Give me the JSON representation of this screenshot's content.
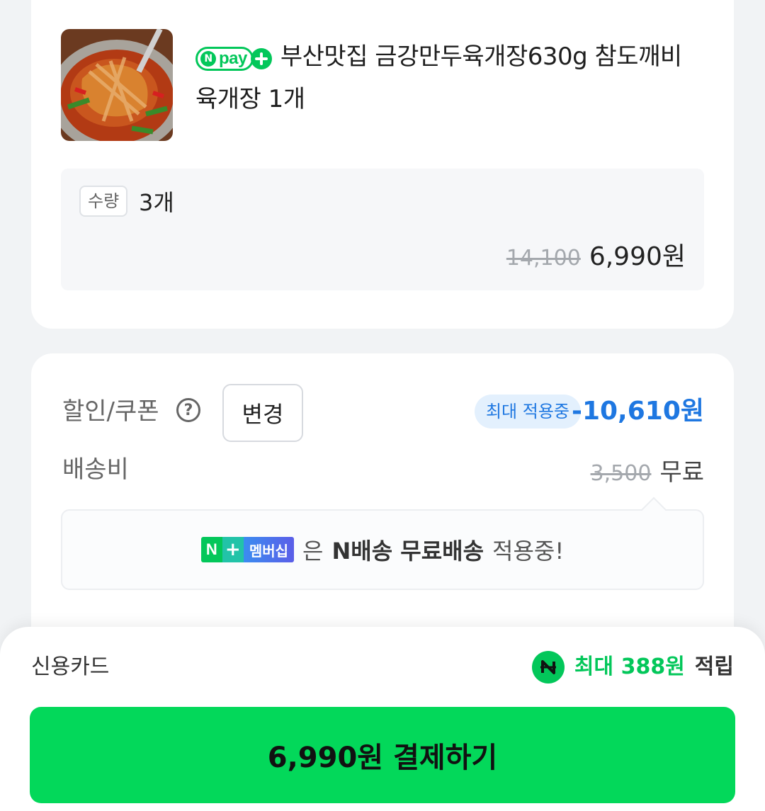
{
  "product": {
    "badge_text": "pay",
    "title": "부산맛집 금강만두육개장630g 참도깨비 육개장 1개",
    "thumbnail_icon": "food-photo",
    "quantity_label": "수량",
    "quantity_value": "3개",
    "original_price": "14,100",
    "price": "6,990원"
  },
  "discount": {
    "label": "할인/쿠폰",
    "help_icon": "question-circle-icon",
    "change_button": "변경",
    "badge": "최대 적용중",
    "amount": "-10,610원"
  },
  "shipping": {
    "label": "배송비",
    "original_fee": "3,500",
    "fee": "무료",
    "membership_badge": {
      "n": "N",
      "plus": "+",
      "text": "멤버십"
    },
    "notice_particle": "은",
    "notice_bold": "N배송 무료배송",
    "notice_tail": "적용중!"
  },
  "payment": {
    "method": "신용카드",
    "reward_green": "최대 388원",
    "reward_dark": "적립",
    "reward_icon": "npay-point-icon",
    "pay_button": "6,990원 결제하기"
  },
  "colors": {
    "naver_green": "#03c75a",
    "button_green": "#03d85a",
    "discount_blue": "#1e77e1"
  }
}
